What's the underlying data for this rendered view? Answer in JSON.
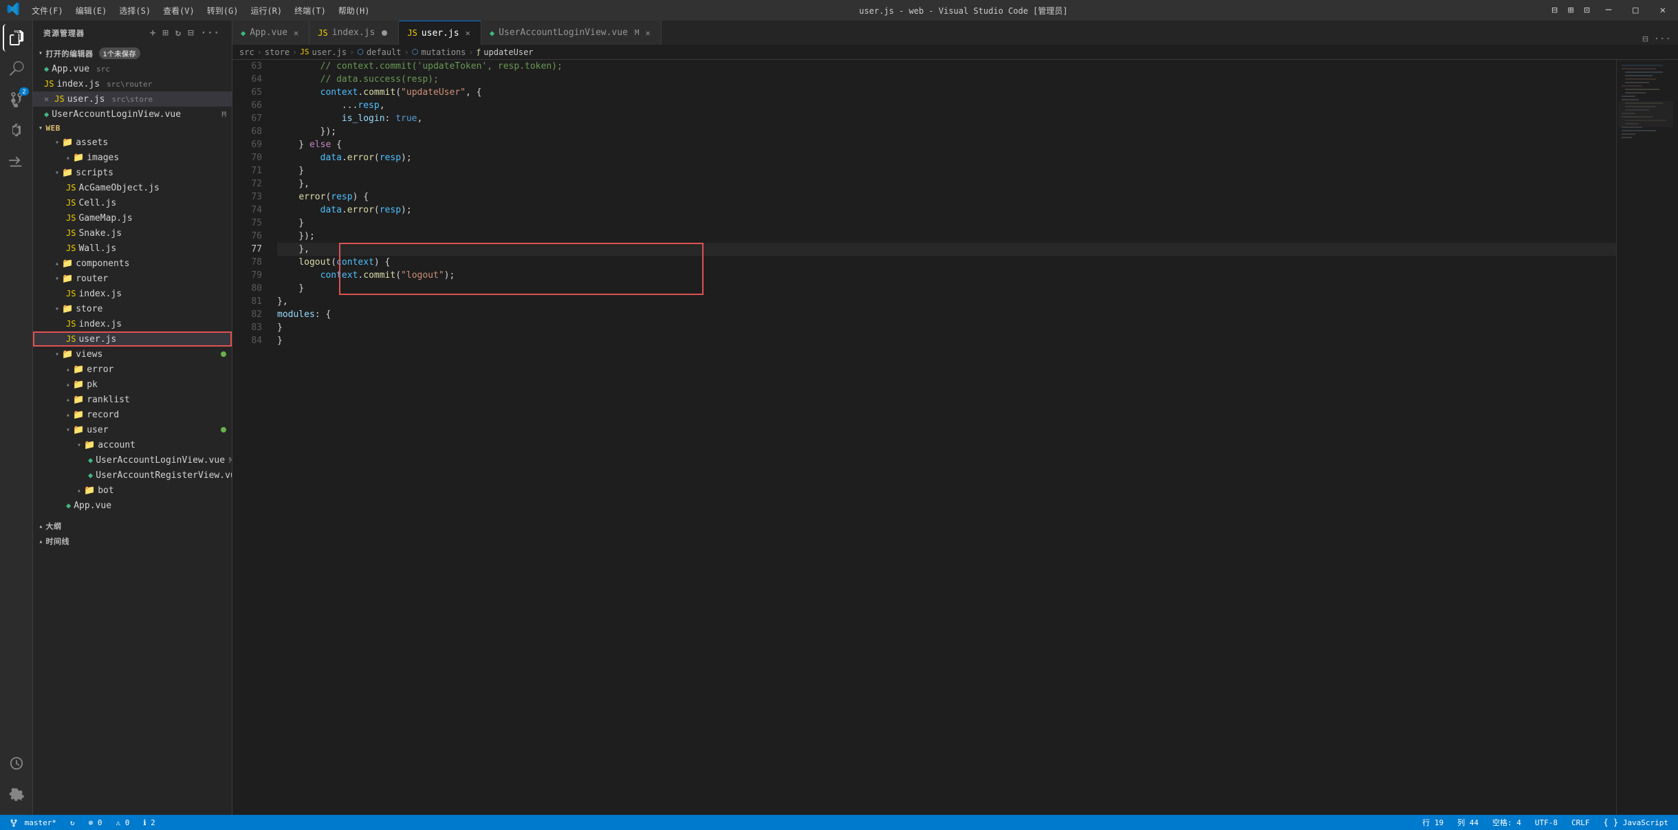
{
  "titleBar": {
    "title": "user.js - web - Visual Studio Code [管理员]",
    "menus": [
      "文件(F)",
      "编辑(E)",
      "选择(S)",
      "查看(V)",
      "转到(G)",
      "运行(R)",
      "终端(T)",
      "帮助(H)"
    ]
  },
  "tabs": [
    {
      "id": "app-vue",
      "icon": "vue",
      "label": "App.vue",
      "modified": false,
      "active": false
    },
    {
      "id": "index-js",
      "icon": "js",
      "label": "index.js",
      "modified": true,
      "active": false
    },
    {
      "id": "user-js",
      "icon": "js",
      "label": "user.js",
      "modified": false,
      "active": true
    },
    {
      "id": "user-account-login",
      "icon": "vue",
      "label": "UserAccountLoginView.vue",
      "modified": true,
      "active": false
    }
  ],
  "breadcrumb": {
    "parts": [
      "src",
      "store",
      "user.js",
      "default",
      "mutations",
      "updateUser"
    ]
  },
  "sidebar": {
    "title": "资源管理器",
    "openEditors": {
      "label": "打开的编辑器",
      "badge": "1个未保存",
      "files": [
        {
          "icon": "vue",
          "label": "App.vue",
          "path": "src",
          "modified": false
        },
        {
          "icon": "js",
          "label": "index.js",
          "path": "src\\router",
          "modified": false
        },
        {
          "icon": "js",
          "label": "user.js",
          "path": "src\\store",
          "modified": false,
          "active": true
        },
        {
          "icon": "vue",
          "label": "UserAccountLoginView.vue",
          "path": "",
          "modified": true
        }
      ]
    },
    "tree": {
      "root": "WEB",
      "items": []
    }
  },
  "statusBar": {
    "branch": "master*",
    "errors": "0",
    "warnings": "0",
    "info": "2",
    "line": "行 19",
    "col": "列 44",
    "spaces": "空格: 4",
    "encoding": "UTF-8",
    "eol": "CRLF",
    "language": "JavaScript"
  },
  "codeLines": [
    {
      "num": 63,
      "content": "        // context.commit('updateToken', resp.token);"
    },
    {
      "num": 64,
      "content": "        // data.success(resp);"
    },
    {
      "num": 65,
      "content": "        context.commit(\"updateUser\", {",
      "parts": [
        {
          "text": "        ",
          "cls": "plain"
        },
        {
          "text": "context",
          "cls": "val"
        },
        {
          "text": ".",
          "cls": "punc"
        },
        {
          "text": "commit",
          "cls": "fn"
        },
        {
          "text": "(\"updateUser\", {",
          "cls": "punc"
        }
      ]
    },
    {
      "num": 66,
      "content": "            ...resp,",
      "parts": [
        {
          "text": "            ...",
          "cls": "plain"
        },
        {
          "text": "resp",
          "cls": "val"
        },
        {
          "text": ",",
          "cls": "punc"
        }
      ]
    },
    {
      "num": 67,
      "content": "            is_login: true,",
      "parts": [
        {
          "text": "            ",
          "cls": "plain"
        },
        {
          "text": "is_login",
          "cls": "prop"
        },
        {
          "text": ": ",
          "cls": "punc"
        },
        {
          "text": "true",
          "cls": "kw"
        },
        {
          "text": ",",
          "cls": "punc"
        }
      ]
    },
    {
      "num": 68,
      "content": "        });"
    },
    {
      "num": 69,
      "content": "    } else {"
    },
    {
      "num": 70,
      "content": "        data.error(resp);"
    },
    {
      "num": 71,
      "content": "    }"
    },
    {
      "num": 72,
      "content": "    },"
    },
    {
      "num": 73,
      "content": "    error(resp) {"
    },
    {
      "num": 74,
      "content": "        data.error(resp);"
    },
    {
      "num": 75,
      "content": "    }"
    },
    {
      "num": 76,
      "content": "    });"
    },
    {
      "num": 77,
      "content": "    },"
    },
    {
      "num": 78,
      "content": "    logout(context) {"
    },
    {
      "num": 79,
      "content": "        context.commit(\"logout\");"
    },
    {
      "num": 80,
      "content": "    }"
    },
    {
      "num": 81,
      "content": "},"
    },
    {
      "num": 82,
      "content": "modules: {"
    },
    {
      "num": 83,
      "content": "}"
    },
    {
      "num": 84,
      "content": "}"
    }
  ]
}
